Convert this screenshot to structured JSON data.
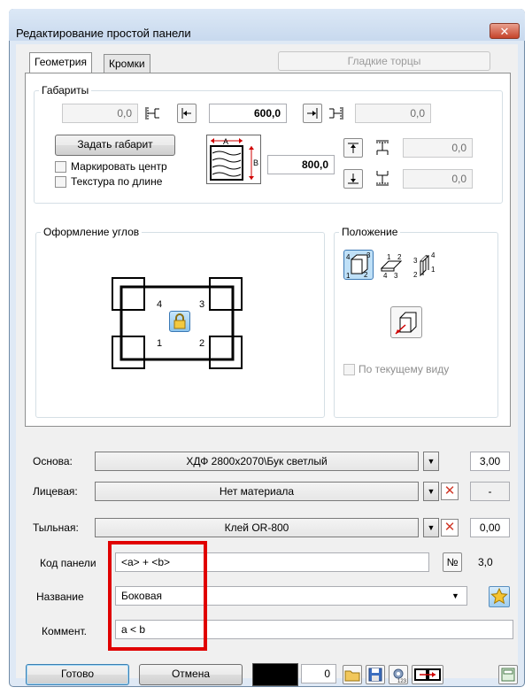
{
  "window": {
    "title": "Редактирование простой панели",
    "close_glyph": "✕"
  },
  "tabs": [
    {
      "label": "Геометрия",
      "active": true
    },
    {
      "label": "Кромки",
      "active": false
    }
  ],
  "smooth_ends_label": "Гладкие торцы",
  "dimensions": {
    "group_label": "Габариты",
    "left_offset": "0,0",
    "width": "600,0",
    "right_offset": "0,0",
    "set_size_label": "Задать габарит",
    "height": "800,0",
    "top_offset": "0,0",
    "bottom_offset": "0,0",
    "mark_center_label": "Маркировать центр",
    "texture_length_label": "Текстура по длине",
    "diagram_a": "A",
    "diagram_b": "B"
  },
  "corners": {
    "group_label": "Оформление углов",
    "labels": [
      "4",
      "3",
      "1",
      "2"
    ]
  },
  "position": {
    "group_label": "Положение",
    "current_view_label": "По текущему виду",
    "btn1_nums": [
      "4",
      "3",
      "1",
      "2"
    ],
    "btn2_nums": [
      "1",
      "2",
      "4",
      "3"
    ],
    "btn3_nums": [
      "3",
      "4",
      "2",
      "1"
    ]
  },
  "materials": {
    "base_label": "Основа:",
    "base_value": "ХДФ 2800x2070\\Бук светлый",
    "base_thickness": "3,00",
    "face_label": "Лицевая:",
    "face_value": "Нет материала",
    "face_thickness": "-",
    "back_label": "Тыльная:",
    "back_value": "Клей OR-800",
    "back_thickness": "0,00"
  },
  "panel_code": {
    "label": "Код панели",
    "value": "<a> + <b>",
    "num_label": "№",
    "num_value": "3,0"
  },
  "panel_name": {
    "label": "Название",
    "value": "Боковая"
  },
  "comment": {
    "label": "Коммент.",
    "value": "a < b"
  },
  "footer": {
    "ok_label": "Готово",
    "cancel_label": "Отмена",
    "counter": "0"
  },
  "colors": {
    "accent_red": "#e00000",
    "selected_color": "#000000"
  }
}
